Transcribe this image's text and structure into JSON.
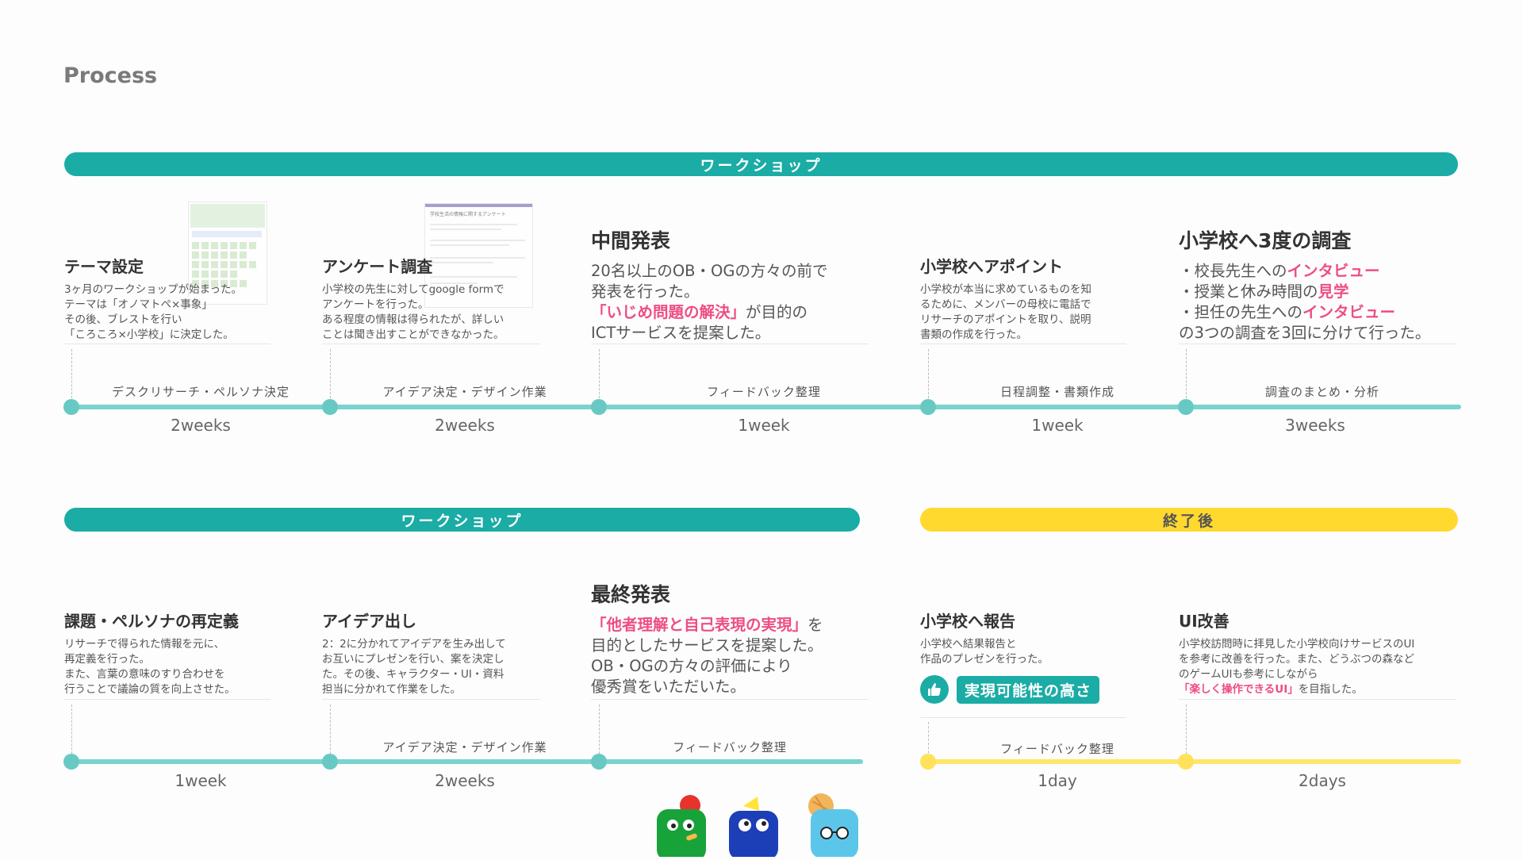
{
  "title": "Process",
  "row1": {
    "band": "ワークショップ",
    "steps": [
      {
        "title": "テーマ設定",
        "desc": [
          "3ヶ月のワークショップが始まった。",
          "テーマは「オノマトペ×事象」",
          "その後、ブレストを行い",
          "「ころころ×小学校」に決定した。"
        ]
      },
      {
        "title": "アンケート調査",
        "desc": [
          "小学校の先生に対してgoogle formで",
          "アンケートを行った。",
          "ある程度の情報は得られたが、詳しい",
          "ことは聞き出すことができなかった。"
        ]
      },
      {
        "title": "中間発表",
        "desc": [
          "20名以上のOB・OGの方々の前で",
          "発表を行った。"
        ],
        "highlight": "「いじめ問題の解決」",
        "after": "が目的の",
        "last": "ICTサービスを提案した。"
      },
      {
        "title": "小学校へアポイント",
        "desc": [
          "小学校が本当に求めているものを知",
          "るために、メンバーの母校に電話で",
          "リサーチのアポイントを取り、説明",
          "書類の作成を行った。"
        ]
      },
      {
        "title": "小学校へ3度の調査",
        "items": [
          {
            "pre": "・校長先生への",
            "hl": "インタビュー"
          },
          {
            "pre": "・授業と休み時間の",
            "hl": "見学"
          },
          {
            "pre": "・担任の先生への",
            "hl": "インタビュー"
          }
        ],
        "last": "の3つの調査を3回に分けて行った。"
      }
    ],
    "segments": [
      {
        "label": "デスクリサーチ・ペルソナ決定",
        "duration": "2weeks"
      },
      {
        "label": "アイデア決定・デザイン作業",
        "duration": "2weeks"
      },
      {
        "label": "フィードバック整理",
        "duration": "1week"
      },
      {
        "label": "日程調整・書類作成",
        "duration": "1week"
      },
      {
        "label": "調査のまとめ・分析",
        "duration": "3weeks"
      }
    ],
    "thumb2_title": "学校生活の情報に関するアンケート"
  },
  "row2": {
    "band_left": "ワークショップ",
    "band_right": "終了後",
    "steps": [
      {
        "title": "課題・ペルソナの再定義",
        "desc": [
          "リサーチで得られた情報を元に、",
          "再定義を行った。",
          "また、言葉の意味のすり合わせを",
          "行うことで議論の質を向上させた。"
        ]
      },
      {
        "title": "アイデア出し",
        "desc": [
          "2：2に分かれてアイデアを生み出して",
          "お互いにプレゼンを行い、案を決定し",
          "た。その後、キャラクター・UI・資料",
          "担当に分かれて作業をした。"
        ]
      },
      {
        "title": "最終発表",
        "highlight": "「他者理解と自己表現の実現」",
        "after": "を",
        "desc": [
          "目的としたサービスを提案した。",
          "OB・OGの方々の評価により",
          "優秀賞をいただいた。"
        ]
      },
      {
        "title": "小学校へ報告",
        "desc": [
          "小学校へ結果報告と",
          "作品のプレゼンを行った。"
        ],
        "badge": "実現可能性の高さ"
      },
      {
        "title": "UI改善",
        "desc": [
          "小学校訪問時に拝見した小学校向けサービスのUI",
          "を参考に改善を行った。また、どうぶつの森など",
          "のゲームUIも参考にしながら"
        ],
        "highlight": "「楽しく操作できるUI」",
        "after": "を目指した。"
      }
    ],
    "segments": [
      {
        "label": "",
        "duration": "1week"
      },
      {
        "label": "アイデア決定・デザイン作業",
        "duration": "2weeks"
      },
      {
        "label": "フィードバック整理",
        "duration": ""
      },
      {
        "label": "フィードバック整理",
        "duration": "1day"
      },
      {
        "label": "",
        "duration": "2days"
      }
    ]
  },
  "colors": {
    "teal": "#1aaca5",
    "teal_light": "#79d3ce",
    "yellow": "#ffd92e",
    "pink": "#ee4d85"
  },
  "icons": {
    "badge": "thumbs-up-icon"
  }
}
